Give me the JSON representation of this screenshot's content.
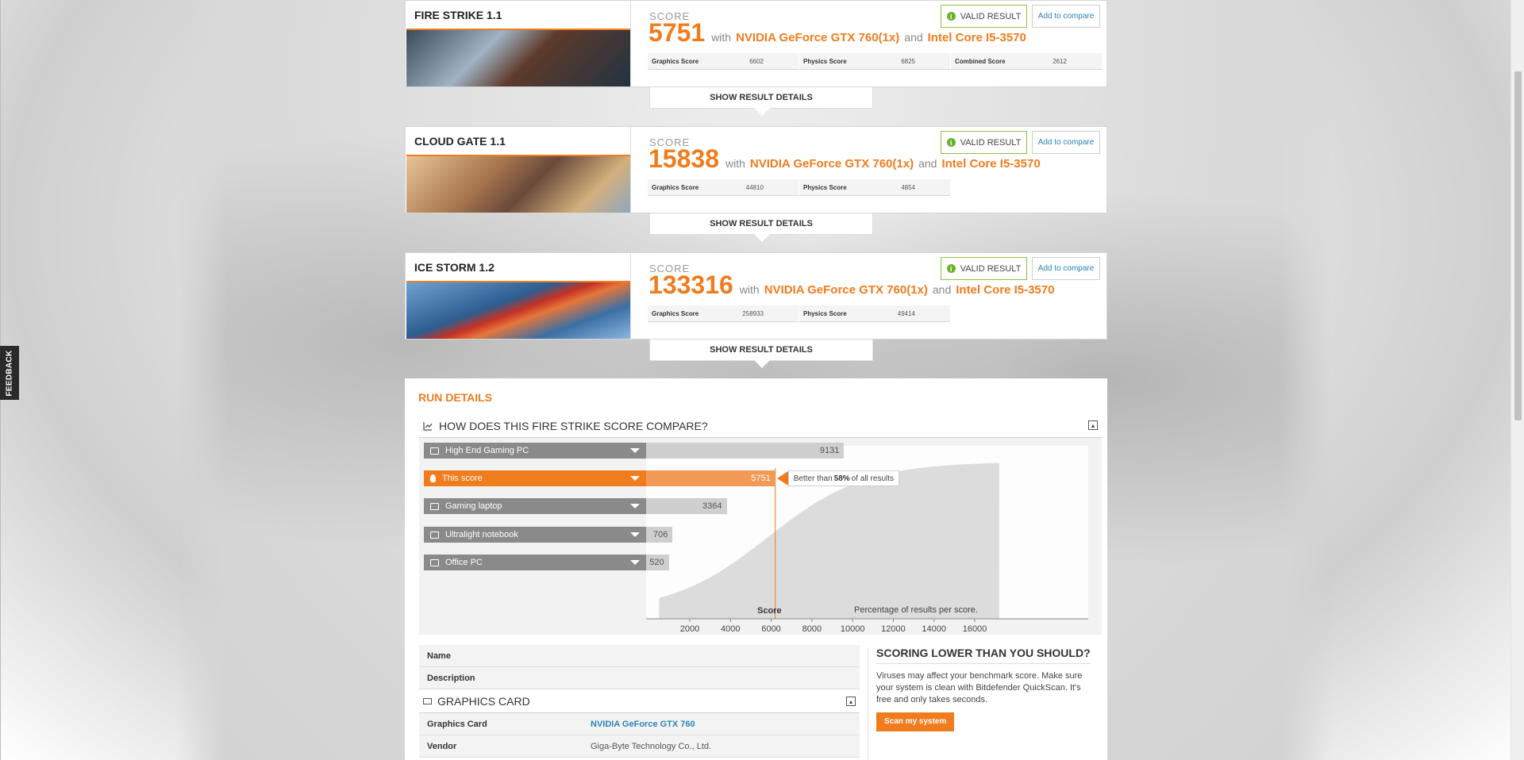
{
  "feedback_label": "FEEDBACK",
  "results": [
    {
      "title": "FIRE STRIKE 1.1",
      "score_label": "SCORE",
      "score": "5751",
      "with": "with",
      "gpu": "NVIDIA GeForce GTX 760(1x)",
      "and": "and",
      "cpu": "Intel Core I5-3570",
      "valid": "VALID RESULT",
      "compare": "Add to compare",
      "subscores": [
        {
          "label": "Graphics Score",
          "value": "6602"
        },
        {
          "label": "Physics Score",
          "value": "6825"
        },
        {
          "label": "Combined Score",
          "value": "2612"
        }
      ],
      "details": "SHOW RESULT DETAILS"
    },
    {
      "title": "CLOUD GATE 1.1",
      "score_label": "SCORE",
      "score": "15838",
      "with": "with",
      "gpu": "NVIDIA GeForce GTX 760(1x)",
      "and": "and",
      "cpu": "Intel Core I5-3570",
      "valid": "VALID RESULT",
      "compare": "Add to compare",
      "subscores": [
        {
          "label": "Graphics Score",
          "value": "44810"
        },
        {
          "label": "Physics Score",
          "value": "4854"
        }
      ],
      "details": "SHOW RESULT DETAILS"
    },
    {
      "title": "ICE STORM 1.2",
      "score_label": "SCORE",
      "score": "133316",
      "with": "with",
      "gpu": "NVIDIA GeForce GTX 760(1x)",
      "and": "and",
      "cpu": "Intel Core I5-3570",
      "valid": "VALID RESULT",
      "compare": "Add to compare",
      "subscores": [
        {
          "label": "Graphics Score",
          "value": "258933"
        },
        {
          "label": "Physics Score",
          "value": "49414"
        }
      ],
      "details": "SHOW RESULT DETAILS"
    }
  ],
  "run_details": {
    "title": "RUN DETAILS",
    "compare_heading": "HOW DOES THIS FIRE STRIKE SCORE COMPARE?",
    "better_prefix": "Better than",
    "better_pct": "58%",
    "better_suffix": "of all results",
    "score_axis": "Score",
    "pct_note": "Percentage of results per score.",
    "info": [
      {
        "key": "Name",
        "value": ""
      },
      {
        "key": "Description",
        "value": ""
      }
    ],
    "graphics_heading": "GRAPHICS CARD",
    "graphics_rows": [
      {
        "key": "Graphics Card",
        "value": "NVIDIA GeForce GTX 760"
      },
      {
        "key": "Vendor",
        "value": "Giga-Byte Technology Co., Ltd."
      }
    ],
    "scoring_title": "SCORING LOWER THAN YOU SHOULD?",
    "scoring_text": "Viruses may affect your benchmark score. Make sure your system is clean with Bitdefender QuickScan. It's free and only takes seconds.",
    "scan_button": "Scan my system"
  },
  "chart_data": {
    "type": "bar",
    "categories": [
      "High End Gaming PC",
      "This score",
      "Gaming laptop",
      "Ultralight notebook",
      "Office PC"
    ],
    "values": [
      9131,
      5751,
      3364,
      706,
      520
    ],
    "highlight": "This score",
    "xlabel": "Score",
    "xticks": [
      2000,
      4000,
      6000,
      8000,
      10000,
      12000,
      14000,
      16000
    ],
    "xlim": [
      0,
      17500
    ],
    "distribution_note": "Percentage of results per score."
  },
  "colors": {
    "accent": "#f07c1e",
    "valid_green": "#6bb22a",
    "link_blue": "#2b83b8"
  }
}
